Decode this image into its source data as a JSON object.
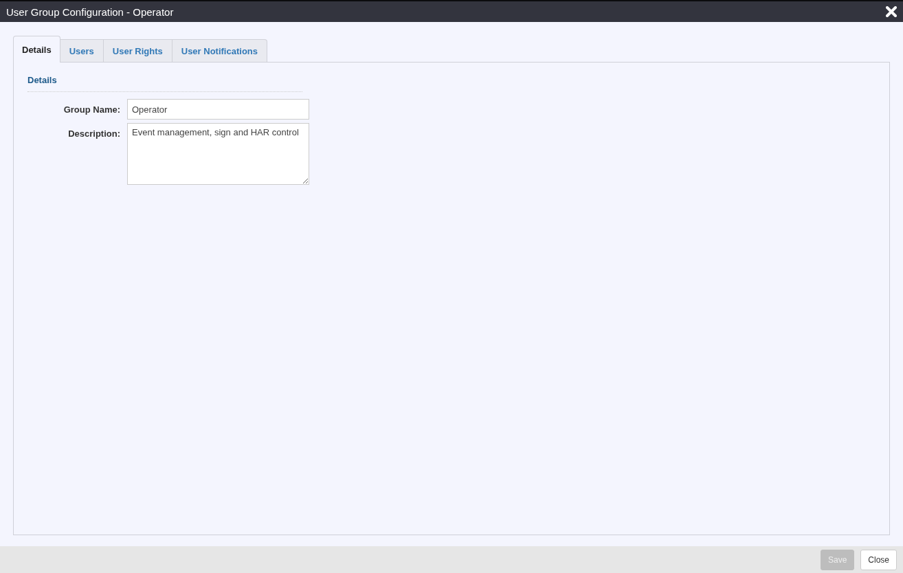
{
  "window": {
    "title": "User Group Configuration - Operator"
  },
  "tabs": [
    {
      "label": "Details",
      "selected": true
    },
    {
      "label": "Users",
      "selected": false
    },
    {
      "label": "User Rights",
      "selected": false
    },
    {
      "label": "User Notifications",
      "selected": false
    }
  ],
  "section": {
    "title": "Details"
  },
  "fields": [
    {
      "kind": "input",
      "label": "Group Name:",
      "value": "Operator"
    },
    {
      "kind": "textarea",
      "label": "Description:",
      "value": "Event management, sign and HAR control"
    }
  ],
  "buttons": [
    {
      "label": "Save",
      "disabled": true
    },
    {
      "label": "Close",
      "disabled": false
    }
  ]
}
